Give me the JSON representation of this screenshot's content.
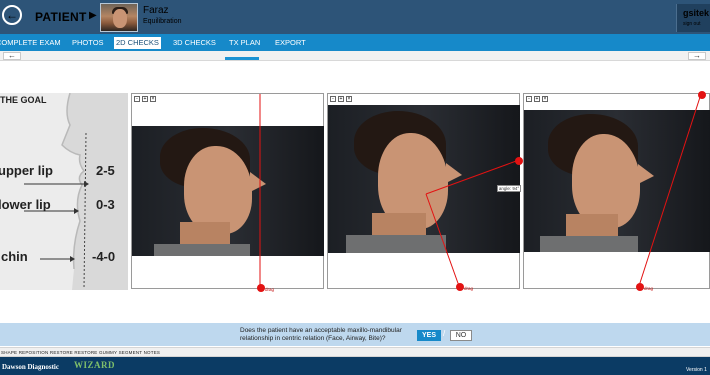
{
  "header": {
    "patient_label": "PATIENT",
    "patient_arrow": "▶",
    "patient_name": "Faraz",
    "patient_sub": "Equilibration",
    "user_name": "gsitek",
    "signout": "sign out"
  },
  "tabs": [
    {
      "label": "COMPLETE EXAM"
    },
    {
      "label": "PHOTOS"
    },
    {
      "label": "2D CHECKS",
      "active": true
    },
    {
      "label": "3D CHECKS"
    },
    {
      "label": "TX PLAN"
    },
    {
      "label": "EXPORT"
    }
  ],
  "nav": {
    "prev": "←",
    "next": "→"
  },
  "goal": {
    "title": "THE GOAL",
    "rows": [
      {
        "label": "upper lip",
        "value": "2-5"
      },
      {
        "label": "lower lip",
        "value": "0-3"
      },
      {
        "label": "chin",
        "value": "-4-0"
      }
    ]
  },
  "panels": [
    {
      "drag_label": "drag"
    },
    {
      "drag_label": "drag",
      "angle_label": "angle: 94°"
    },
    {
      "drag_label": "drag"
    }
  ],
  "question": {
    "text": "Does the patient have an acceptable maxillo-mandibular relationship in centric relation (Face, Airway, Bite)?",
    "yes": "YES",
    "slash": "/",
    "no": "NO"
  },
  "subnav": {
    "items": "SHAPE   REPOSITION   RESTORE   RESTORE GUMMY SEGMENT   NOTES"
  },
  "footer": {
    "brand": "Dawson Diagnostic",
    "brand_accent": "WIZARD",
    "version": "Version 1"
  },
  "colors": {
    "header": "#2d5478",
    "tabbar": "#1689c9",
    "accent_red": "#e31212",
    "footer": "#0b3b64"
  }
}
